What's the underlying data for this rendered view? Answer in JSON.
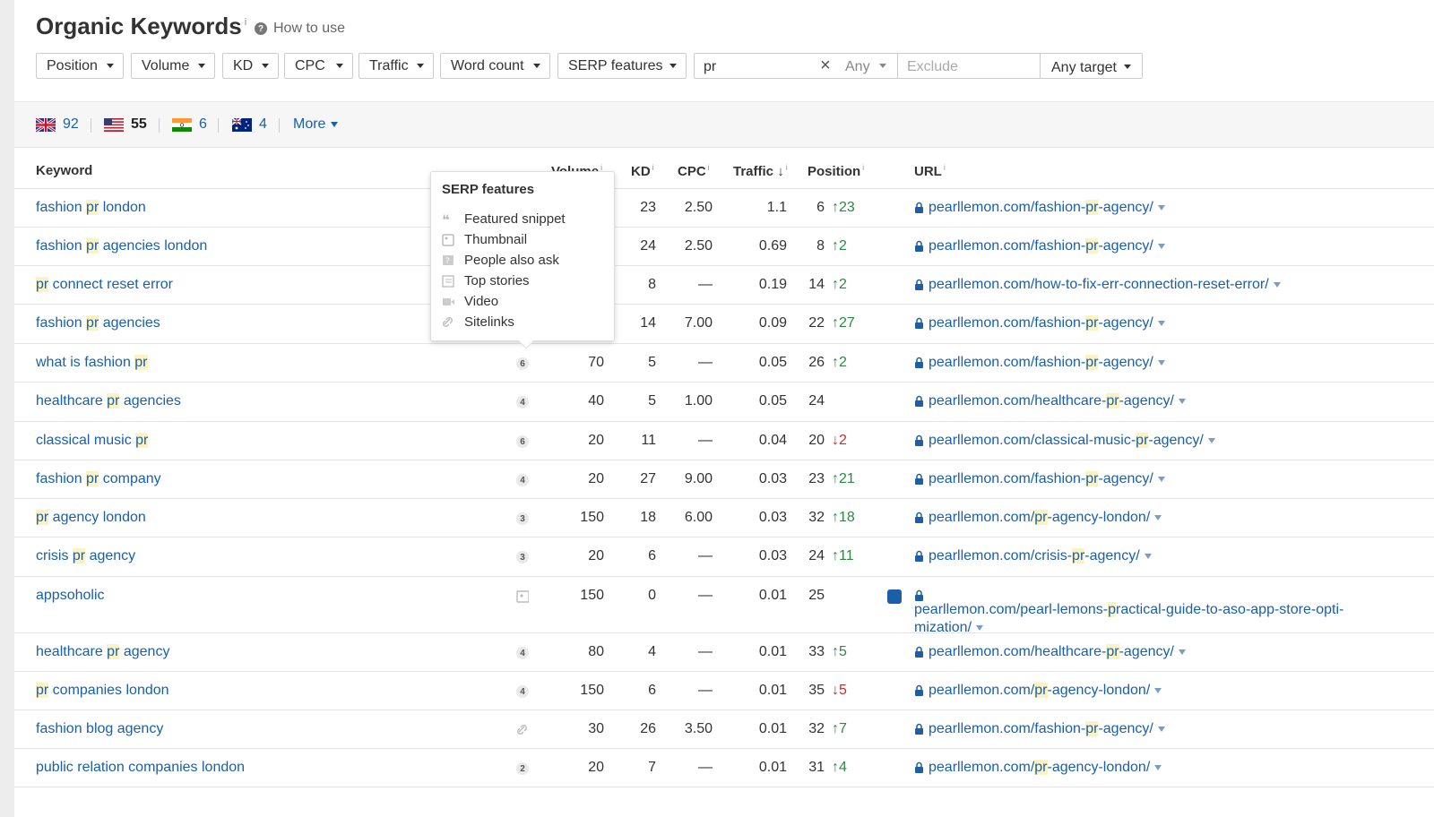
{
  "header": {
    "title": "Organic Keywords",
    "title_sup": "i",
    "how_to_use": "How to use"
  },
  "filters": {
    "position": "Position",
    "volume": "Volume",
    "kd": "KD",
    "cpc": "CPC",
    "traffic": "Traffic",
    "word_count": "Word count",
    "serp_features": "SERP features",
    "search_value": "pr",
    "search_mode": "Any",
    "exclude_placeholder": "Exclude",
    "target": "Any target"
  },
  "countries": [
    {
      "flag": "uk-flag-icon",
      "count": "92"
    },
    {
      "flag": "us-flag-icon",
      "count": "55"
    },
    {
      "flag": "india-flag-icon",
      "count": "6"
    },
    {
      "flag": "australia-flag-icon",
      "count": "4"
    }
  ],
  "more": "More",
  "columns": {
    "keyword": "Keyword",
    "volume": "Volume",
    "kd": "KD",
    "cpc": "CPC",
    "traffic": "Traffic",
    "traffic_sort": "↓",
    "position": "Position",
    "url": "URL",
    "info": "i"
  },
  "tooltip": {
    "title": "SERP features",
    "items": [
      "Featured snippet",
      "Thumbnail",
      "People also ask",
      "Top stories",
      "Video",
      "Sitelinks"
    ]
  },
  "rows": [
    {
      "kw_pre": "fashion ",
      "kw_hl": "pr",
      "kw_post": " london",
      "kw_pre2": "",
      "feat": "",
      "volume": "",
      "kd": "23",
      "cpc": "2.50",
      "traffic": "1.1",
      "position": "6",
      "change": "23",
      "dir": "up",
      "url_pre": "pearllemon.com/fashion-",
      "url_hl": "pr",
      "url_post": "-agency/"
    },
    {
      "kw_pre": "fashion ",
      "kw_hl": "pr",
      "kw_post": " agencies london",
      "feat": "",
      "volume": "",
      "kd": "24",
      "cpc": "2.50",
      "traffic": "0.69",
      "position": "8",
      "change": "2",
      "dir": "up",
      "url_pre": "pearllemon.com/fashion-",
      "url_hl": "pr",
      "url_post": "-agency/"
    },
    {
      "kw_pre": "",
      "kw_hl": "pr",
      "kw_post": " connect reset error",
      "feat": "",
      "volume": "",
      "kd": "8",
      "cpc": "—",
      "traffic": "0.19",
      "position": "14",
      "change": "2",
      "dir": "up",
      "url_pre": "pearllemon.com/how-to-fix-err-connection-reset-error/",
      "url_hl": "",
      "url_post": ""
    },
    {
      "kw_pre": "fashion ",
      "kw_hl": "pr",
      "kw_post": " agencies",
      "feat": "",
      "volume": "",
      "kd": "14",
      "cpc": "7.00",
      "traffic": "0.09",
      "position": "22",
      "change": "27",
      "dir": "up",
      "url_pre": "pearllemon.com/fashion-",
      "url_hl": "pr",
      "url_post": "-agency/"
    },
    {
      "kw_pre": "what is fashion ",
      "kw_hl": "pr",
      "kw_post": "",
      "feat": "6",
      "volume": "70",
      "kd": "5",
      "cpc": "—",
      "traffic": "0.05",
      "position": "26",
      "change": "2",
      "dir": "up",
      "url_pre": "pearllemon.com/fashion-",
      "url_hl": "pr",
      "url_post": "-agency/"
    },
    {
      "kw_pre": "healthcare ",
      "kw_hl": "pr",
      "kw_post": " agencies",
      "feat": "4",
      "volume": "40",
      "kd": "5",
      "cpc": "1.00",
      "traffic": "0.05",
      "position": "24",
      "change": "",
      "dir": "",
      "url_pre": "pearllemon.com/healthcare-",
      "url_hl": "pr",
      "url_post": "-agency/"
    },
    {
      "kw_pre": "classical music ",
      "kw_hl": "pr",
      "kw_post": "",
      "feat": "6",
      "volume": "20",
      "kd": "11",
      "cpc": "—",
      "traffic": "0.04",
      "position": "20",
      "change": "2",
      "dir": "down",
      "url_pre": "pearllemon.com/classical-music-",
      "url_hl": "pr",
      "url_post": "-agency/"
    },
    {
      "kw_pre": "fashion ",
      "kw_hl": "pr",
      "kw_post": " company",
      "feat": "4",
      "volume": "20",
      "kd": "27",
      "cpc": "9.00",
      "traffic": "0.03",
      "position": "23",
      "change": "21",
      "dir": "up",
      "url_pre": "pearllemon.com/fashion-",
      "url_hl": "pr",
      "url_post": "-agency/"
    },
    {
      "kw_pre": "",
      "kw_hl": "pr",
      "kw_post": " agency london",
      "feat": "3",
      "volume": "150",
      "kd": "18",
      "cpc": "6.00",
      "traffic": "0.03",
      "position": "32",
      "change": "18",
      "dir": "up",
      "url_pre": "pearllemon.com/",
      "url_hl": "pr",
      "url_post": "-agency-london/"
    },
    {
      "kw_pre": "crisis ",
      "kw_hl": "pr",
      "kw_post": " agency",
      "feat": "3",
      "volume": "20",
      "kd": "6",
      "cpc": "—",
      "traffic": "0.03",
      "position": "24",
      "change": "11",
      "dir": "up",
      "url_pre": "pearllemon.com/crisis-",
      "url_hl": "pr",
      "url_post": "-agency/"
    },
    {
      "kw_pre": "appsoholic",
      "kw_hl": "",
      "kw_post": "",
      "feat": "thumb",
      "volume": "150",
      "kd": "0",
      "cpc": "—",
      "traffic": "0.01",
      "position": "25",
      "change": "",
      "dir": "",
      "url_pre": "pearllemon.com/pearl-lemons-",
      "url_hl": "p",
      "url_post": "ractical-guide-to-aso-app-store-opti-mization/"
    },
    {
      "kw_pre": "healthcare ",
      "kw_hl": "pr",
      "kw_post": " agency",
      "feat": "4",
      "volume": "80",
      "kd": "4",
      "cpc": "—",
      "traffic": "0.01",
      "position": "33",
      "change": "5",
      "dir": "up",
      "url_pre": "pearllemon.com/healthcare-",
      "url_hl": "pr",
      "url_post": "-agency/"
    },
    {
      "kw_pre": "",
      "kw_hl": "pr",
      "kw_post": " companies london",
      "feat": "4",
      "volume": "150",
      "kd": "6",
      "cpc": "—",
      "traffic": "0.01",
      "position": "35",
      "change": "5",
      "dir": "down",
      "url_pre": "pearllemon.com/",
      "url_hl": "pr",
      "url_post": "-agency-london/"
    },
    {
      "kw_pre": "fashion blog agency",
      "kw_hl": "",
      "kw_post": "",
      "feat": "link",
      "volume": "30",
      "kd": "26",
      "cpc": "3.50",
      "traffic": "0.01",
      "position": "32",
      "change": "7",
      "dir": "up",
      "url_pre": "pearllemon.com/fashion-",
      "url_hl": "pr",
      "url_post": "-agency/"
    },
    {
      "kw_pre": "public relation companies london",
      "kw_hl": "",
      "kw_post": "",
      "feat": "2",
      "volume": "20",
      "kd": "7",
      "cpc": "—",
      "traffic": "0.01",
      "position": "31",
      "change": "4",
      "dir": "up",
      "url_pre": "pearllemon.com/",
      "url_hl": "pr",
      "url_post": "-agency-london/"
    }
  ],
  "colors": {
    "link": "#1a5fa8",
    "up": "#2a8a3e",
    "down": "#c92b2b",
    "highlight": "#fbf3c4"
  }
}
